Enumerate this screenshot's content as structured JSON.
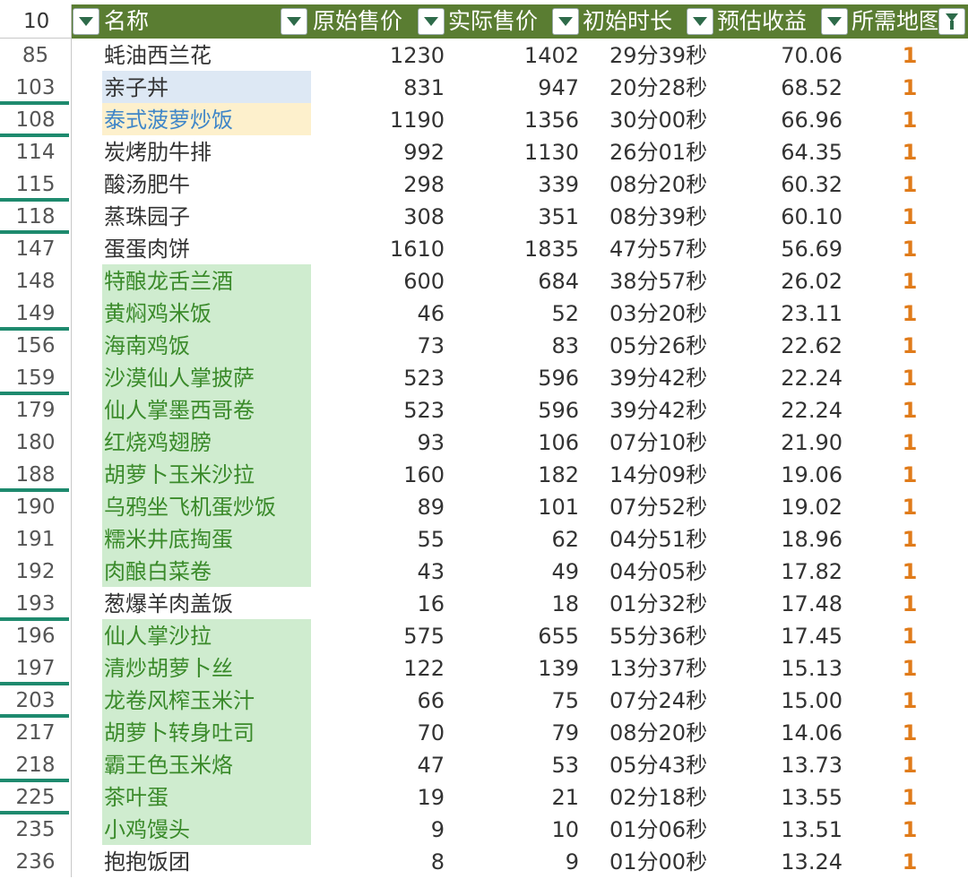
{
  "header": {
    "row_number": "10",
    "columns": [
      "名称",
      "原始售价",
      "实际售价",
      "初始时长",
      "预估收益",
      "所需地图"
    ]
  },
  "rows": [
    {
      "num": "85",
      "name": "蚝油西兰花",
      "orig": "1230",
      "act": "1402",
      "dur": "29分39秒",
      "est": "70.06",
      "map": "1",
      "hl": "none",
      "mark": false
    },
    {
      "num": "103",
      "name": "亲子丼",
      "orig": "831",
      "act": "947",
      "dur": "20分28秒",
      "est": "68.52",
      "map": "1",
      "hl": "blue",
      "mark": true
    },
    {
      "num": "108",
      "name": "泰式菠萝炒饭",
      "orig": "1190",
      "act": "1356",
      "dur": "30分00秒",
      "est": "66.96",
      "map": "1",
      "hl": "amber",
      "mark": true
    },
    {
      "num": "114",
      "name": "炭烤肋牛排",
      "orig": "992",
      "act": "1130",
      "dur": "26分01秒",
      "est": "64.35",
      "map": "1",
      "hl": "none",
      "mark": false
    },
    {
      "num": "115",
      "name": "酸汤肥牛",
      "orig": "298",
      "act": "339",
      "dur": "08分20秒",
      "est": "60.32",
      "map": "1",
      "hl": "none",
      "mark": true
    },
    {
      "num": "118",
      "name": "蒸珠园子",
      "orig": "308",
      "act": "351",
      "dur": "08分39秒",
      "est": "60.10",
      "map": "1",
      "hl": "none",
      "mark": true
    },
    {
      "num": "147",
      "name": "蛋蛋肉饼",
      "orig": "1610",
      "act": "1835",
      "dur": "47分57秒",
      "est": "56.69",
      "map": "1",
      "hl": "none",
      "mark": false
    },
    {
      "num": "148",
      "name": "特酿龙舌兰酒",
      "orig": "600",
      "act": "684",
      "dur": "38分57秒",
      "est": "26.02",
      "map": "1",
      "hl": "green",
      "mark": false
    },
    {
      "num": "149",
      "name": "黄焖鸡米饭",
      "orig": "46",
      "act": "52",
      "dur": "03分20秒",
      "est": "23.11",
      "map": "1",
      "hl": "green",
      "mark": true
    },
    {
      "num": "156",
      "name": "海南鸡饭",
      "orig": "73",
      "act": "83",
      "dur": "05分26秒",
      "est": "22.62",
      "map": "1",
      "hl": "green",
      "mark": false
    },
    {
      "num": "159",
      "name": "沙漠仙人掌披萨",
      "orig": "523",
      "act": "596",
      "dur": "39分42秒",
      "est": "22.24",
      "map": "1",
      "hl": "green",
      "mark": true
    },
    {
      "num": "179",
      "name": "仙人掌墨西哥卷",
      "orig": "523",
      "act": "596",
      "dur": "39分42秒",
      "est": "22.24",
      "map": "1",
      "hl": "green",
      "mark": false
    },
    {
      "num": "180",
      "name": "红烧鸡翅膀",
      "orig": "93",
      "act": "106",
      "dur": "07分10秒",
      "est": "21.90",
      "map": "1",
      "hl": "green",
      "mark": false
    },
    {
      "num": "188",
      "name": "胡萝卜玉米沙拉",
      "orig": "160",
      "act": "182",
      "dur": "14分09秒",
      "est": "19.06",
      "map": "1",
      "hl": "green",
      "mark": true
    },
    {
      "num": "190",
      "name": "乌鸦坐飞机蛋炒饭",
      "orig": "89",
      "act": "101",
      "dur": "07分52秒",
      "est": "19.02",
      "map": "1",
      "hl": "green",
      "mark": false
    },
    {
      "num": "191",
      "name": "糯米井底掏蛋",
      "orig": "55",
      "act": "62",
      "dur": "04分51秒",
      "est": "18.96",
      "map": "1",
      "hl": "green",
      "mark": false
    },
    {
      "num": "192",
      "name": "肉酿白菜卷",
      "orig": "43",
      "act": "49",
      "dur": "04分05秒",
      "est": "17.82",
      "map": "1",
      "hl": "green",
      "mark": false
    },
    {
      "num": "193",
      "name": "葱爆羊肉盖饭",
      "orig": "16",
      "act": "18",
      "dur": "01分32秒",
      "est": "17.48",
      "map": "1",
      "hl": "none",
      "mark": true
    },
    {
      "num": "196",
      "name": "仙人掌沙拉",
      "orig": "575",
      "act": "655",
      "dur": "55分36秒",
      "est": "17.45",
      "map": "1",
      "hl": "green",
      "mark": false
    },
    {
      "num": "197",
      "name": "清炒胡萝卜丝",
      "orig": "122",
      "act": "139",
      "dur": "13分37秒",
      "est": "15.13",
      "map": "1",
      "hl": "green",
      "mark": true
    },
    {
      "num": "203",
      "name": "龙卷风榨玉米汁",
      "orig": "66",
      "act": "75",
      "dur": "07分24秒",
      "est": "15.00",
      "map": "1",
      "hl": "green",
      "mark": true
    },
    {
      "num": "217",
      "name": "胡萝卜转身吐司",
      "orig": "70",
      "act": "79",
      "dur": "08分20秒",
      "est": "14.06",
      "map": "1",
      "hl": "green",
      "mark": false
    },
    {
      "num": "218",
      "name": "霸王色玉米烙",
      "orig": "47",
      "act": "53",
      "dur": "05分43秒",
      "est": "13.73",
      "map": "1",
      "hl": "green",
      "mark": true
    },
    {
      "num": "225",
      "name": "茶叶蛋",
      "orig": "19",
      "act": "21",
      "dur": "02分18秒",
      "est": "13.55",
      "map": "1",
      "hl": "green",
      "mark": true
    },
    {
      "num": "235",
      "name": "小鸡馒头",
      "orig": "9",
      "act": "10",
      "dur": "01分06秒",
      "est": "13.51",
      "map": "1",
      "hl": "green",
      "mark": false
    },
    {
      "num": "236",
      "name": "抱抱饭团",
      "orig": "8",
      "act": "9",
      "dur": "01分00秒",
      "est": "13.24",
      "map": "1",
      "hl": "none",
      "mark": false
    }
  ],
  "colors": {
    "header_bg": "#5a7d32",
    "green_fill": "#cfeccf",
    "green_text": "#3a8a2a",
    "blue_fill": "#dde8f4",
    "amber_fill": "#fdf0cc",
    "amber_text": "#3f86c8",
    "map_text": "#e07b1a",
    "row_marker": "#1e8a6e"
  }
}
